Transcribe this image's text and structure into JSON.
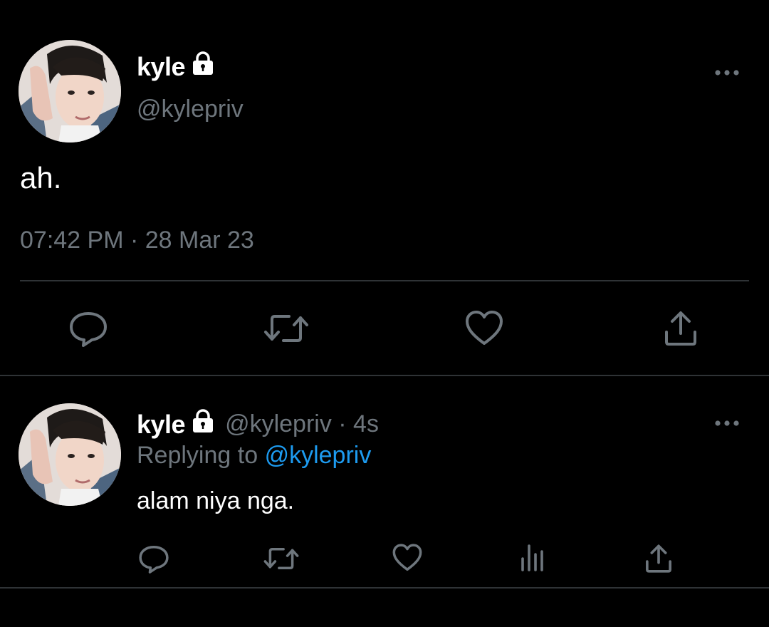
{
  "colors": {
    "background": "#000000",
    "text_primary": "#ffffff",
    "text_secondary": "#6e767d",
    "link": "#1d9bf0",
    "divider": "#2f3336"
  },
  "main_tweet": {
    "display_name": "kyle",
    "protected_icon": "lock-icon",
    "handle": "@kylepriv",
    "more_icon": "more-horizontal-icon",
    "text": "ah.",
    "timestamp": "07:42 PM · 28 Mar 23",
    "actions": [
      {
        "name": "reply",
        "icon": "reply-icon"
      },
      {
        "name": "retweet",
        "icon": "retweet-icon"
      },
      {
        "name": "like",
        "icon": "heart-icon"
      },
      {
        "name": "share",
        "icon": "share-icon"
      }
    ]
  },
  "reply_tweet": {
    "display_name": "kyle",
    "protected_icon": "lock-icon",
    "handle_time": "@kylepriv · 4s",
    "replying_prefix": "Replying to",
    "replying_mention": "@kylepriv",
    "text": "alam niya nga.",
    "more_icon": "more-horizontal-icon",
    "actions": [
      {
        "name": "reply",
        "icon": "reply-icon"
      },
      {
        "name": "retweet",
        "icon": "retweet-icon"
      },
      {
        "name": "like",
        "icon": "heart-icon"
      },
      {
        "name": "analytics",
        "icon": "analytics-icon"
      },
      {
        "name": "share",
        "icon": "share-icon"
      }
    ]
  }
}
